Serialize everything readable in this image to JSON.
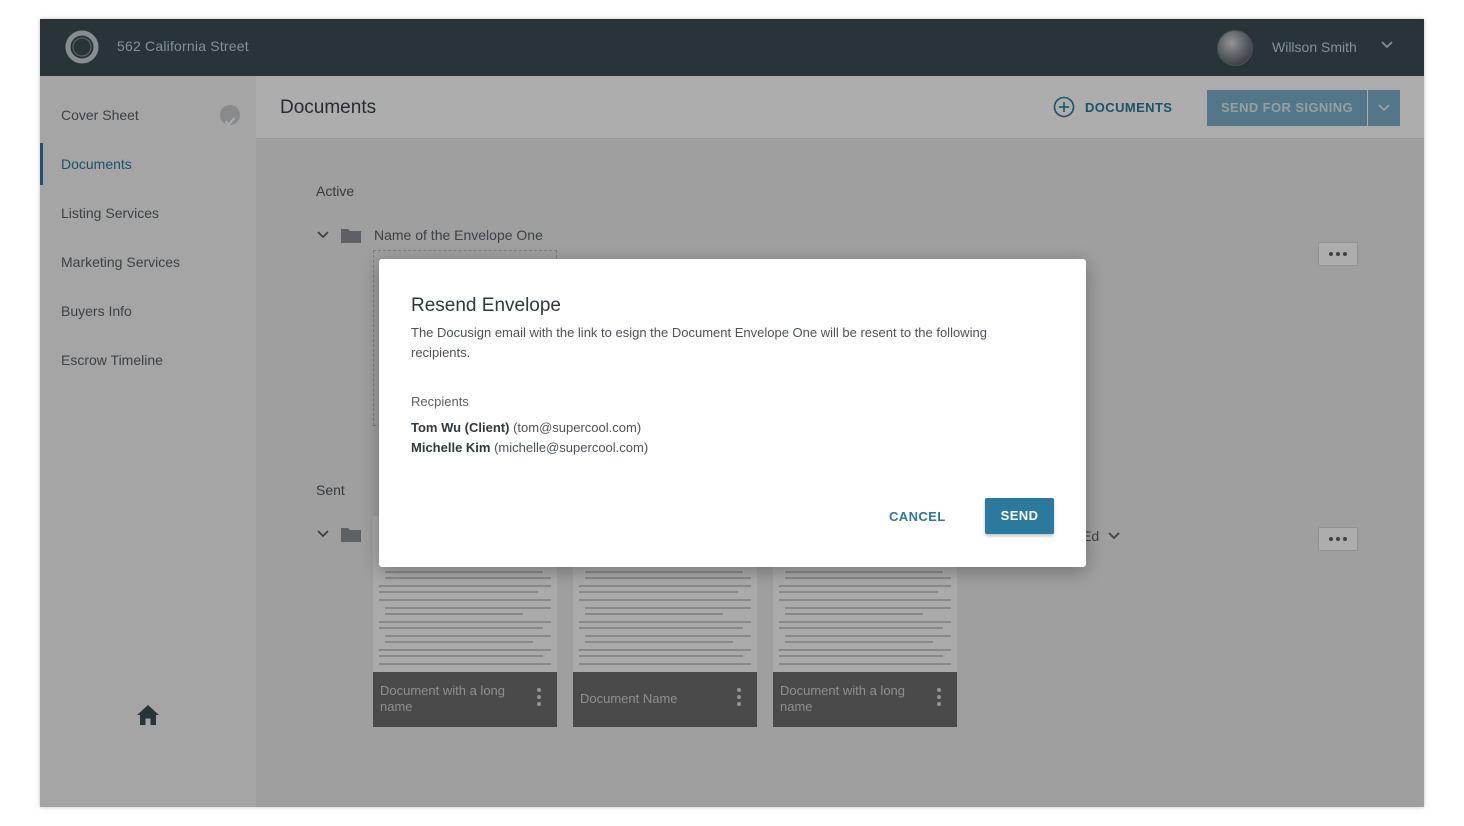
{
  "header": {
    "title": "562 California Street",
    "user_name": "Willson Smith"
  },
  "sidebar": {
    "items": [
      {
        "label": "Cover Sheet",
        "completed": true
      },
      {
        "label": "Documents",
        "active": true
      },
      {
        "label": "Listing Services"
      },
      {
        "label": "Marketing Services"
      },
      {
        "label": "Buyers Info"
      },
      {
        "label": "Escrow Timeline"
      }
    ]
  },
  "main": {
    "title": "Documents",
    "add_documents_label": "DOCUMENTS",
    "send_for_signing_label": "SEND FOR SIGNING",
    "active_label": "Active",
    "active_envelope_name": "Name of the Envelope One",
    "sent_label": "Sent",
    "sent_trailing_text": "Ed",
    "documents": [
      {
        "name": "Document with a long name"
      },
      {
        "name": "Document Name"
      },
      {
        "name": "Document with a long name"
      }
    ]
  },
  "modal": {
    "title": "Resend Envelope",
    "description": "The Docusign email with the link to esign the Document Envelope One will be resent to the following recipients.",
    "recipients_label": "Recpients",
    "recipients": [
      {
        "name": "Tom Wu (Client)",
        "email": "(tom@supercool.com)"
      },
      {
        "name": "Michelle Kim",
        "email": "(michelle@supercool.com)"
      }
    ],
    "cancel_label": "CANCEL",
    "send_label": "SEND"
  },
  "colors": {
    "topbar": "#3d4d55",
    "accent": "#2b7a9e",
    "disabled_button": "#7bb0c9",
    "sidebar_bg": "#f3f3f3"
  },
  "icons": [
    "ring-logo-icon",
    "avatar",
    "chevron-down-icon",
    "check-circle-icon",
    "home-icon",
    "plus-circle-icon",
    "folder-icon",
    "more-horizontal-icon",
    "more-vertical-icon"
  ]
}
